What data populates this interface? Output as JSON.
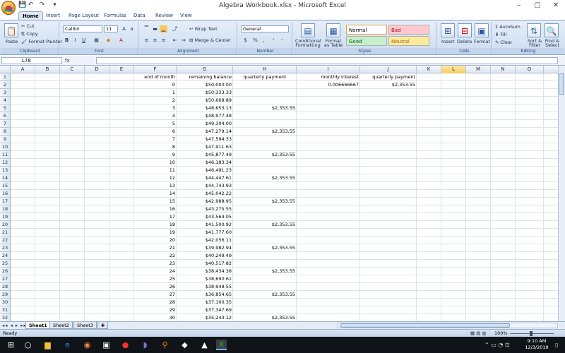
{
  "window": {
    "title": "Algebra Workbook.xlsx - Microsoft Excel",
    "controls": [
      "–",
      "▢",
      "✕"
    ]
  },
  "qat": [
    "💾",
    "↶",
    "↷",
    "▾"
  ],
  "tabs": [
    "Home",
    "Insert",
    "Page Layout",
    "Formulas",
    "Data",
    "Review",
    "View"
  ],
  "ribbon": {
    "clipboard": {
      "label": "Clipboard",
      "paste": "Paste",
      "cut": "Cut",
      "copy": "Copy",
      "format_painter": "Format Painter"
    },
    "font": {
      "label": "Font",
      "name": "Calibri",
      "size": "11"
    },
    "alignment": {
      "label": "Alignment",
      "wrap": "Wrap Text",
      "merge": "Merge & Center"
    },
    "number": {
      "label": "Number",
      "format": "General"
    },
    "styles": {
      "label": "Styles",
      "conditional": "Conditional Formatting",
      "format_table": "Format as Table",
      "cells": [
        {
          "name": "Normal",
          "bg": "#ffffff",
          "fg": "#000000"
        },
        {
          "name": "Bad",
          "bg": "#ffc7ce",
          "fg": "#9c0006"
        },
        {
          "name": "Good",
          "bg": "#c6efce",
          "fg": "#006100"
        },
        {
          "name": "Neutral",
          "bg": "#ffeb9c",
          "fg": "#9c6500"
        }
      ]
    },
    "cells": {
      "label": "Cells",
      "insert": "Insert",
      "delete": "Delete",
      "format": "Format"
    },
    "editing": {
      "label": "Editing",
      "autosum": "AutoSum",
      "fill": "Fill",
      "clear": "Clear",
      "sort": "Sort & Filter",
      "find": "Find & Select"
    }
  },
  "formula_bar": {
    "name_box": "L78",
    "fx": "fx",
    "formula": ""
  },
  "columns": [
    "A",
    "B",
    "C",
    "D",
    "E",
    "F",
    "G",
    "H",
    "I",
    "J",
    "K",
    "L",
    "M",
    "N",
    "O"
  ],
  "selected_column": "L",
  "header_row": {
    "F": "end of month",
    "G": "remaining balance",
    "H": "quarterly payment",
    "I": "monthly interest",
    "J": "quarterly payment"
  },
  "row2_extra": {
    "I": "0.006666667",
    "J": "$2,353.55"
  },
  "rows": [
    {
      "n": 2,
      "F": "0",
      "G": "$50,000.00",
      "H": ""
    },
    {
      "n": 3,
      "F": "1",
      "G": "$50,333.33",
      "H": ""
    },
    {
      "n": 4,
      "F": "2",
      "G": "$50,668.89",
      "H": ""
    },
    {
      "n": 5,
      "F": "3",
      "G": "$48,653.13",
      "H": "$2,353.55"
    },
    {
      "n": 6,
      "F": "4",
      "G": "$48,977.48",
      "H": ""
    },
    {
      "n": 7,
      "F": "5",
      "G": "$49,304.00",
      "H": ""
    },
    {
      "n": 8,
      "F": "6",
      "G": "$47,279.14",
      "H": "$2,353.55"
    },
    {
      "n": 9,
      "F": "7",
      "G": "$47,594.33",
      "H": ""
    },
    {
      "n": 10,
      "F": "8",
      "G": "$47,911.63",
      "H": ""
    },
    {
      "n": 11,
      "F": "9",
      "G": "$45,877.49",
      "H": "$2,353.55"
    },
    {
      "n": 12,
      "F": "10",
      "G": "$46,183.34",
      "H": ""
    },
    {
      "n": 13,
      "F": "11",
      "G": "$46,491.23",
      "H": ""
    },
    {
      "n": 14,
      "F": "12",
      "G": "$44,447.61",
      "H": "$2,353.55"
    },
    {
      "n": 15,
      "F": "13",
      "G": "$44,743.93",
      "H": ""
    },
    {
      "n": 16,
      "F": "14",
      "G": "$45,042.22",
      "H": ""
    },
    {
      "n": 17,
      "F": "15",
      "G": "$42,988.95",
      "H": "$2,353.55"
    },
    {
      "n": 18,
      "F": "16",
      "G": "$43,275.55",
      "H": ""
    },
    {
      "n": 19,
      "F": "17",
      "G": "$43,564.05",
      "H": ""
    },
    {
      "n": 20,
      "F": "18",
      "G": "$41,500.92",
      "H": "$2,353.55"
    },
    {
      "n": 21,
      "F": "19",
      "G": "$41,777.60",
      "H": ""
    },
    {
      "n": 22,
      "F": "20",
      "G": "$42,056.11",
      "H": ""
    },
    {
      "n": 23,
      "F": "21",
      "G": "$39,982.94",
      "H": "$2,353.55"
    },
    {
      "n": 24,
      "F": "22",
      "G": "$40,249.49",
      "H": ""
    },
    {
      "n": 25,
      "F": "23",
      "G": "$40,517.82",
      "H": ""
    },
    {
      "n": 26,
      "F": "24",
      "G": "$38,434.38",
      "H": "$2,353.55"
    },
    {
      "n": 27,
      "F": "25",
      "G": "$38,690.61",
      "H": ""
    },
    {
      "n": 28,
      "F": "26",
      "G": "$38,948.55",
      "H": ""
    },
    {
      "n": 29,
      "F": "27",
      "G": "$36,854.65",
      "H": "$2,353.55"
    },
    {
      "n": 30,
      "F": "28",
      "G": "$37,100.35",
      "H": ""
    },
    {
      "n": 31,
      "F": "29",
      "G": "$37,347.69",
      "H": ""
    },
    {
      "n": 32,
      "F": "30",
      "G": "$35,243.12",
      "H": "$2,353.55"
    }
  ],
  "sheets": [
    "Sheet1",
    "Sheet2",
    "Sheet3"
  ],
  "active_sheet": "Sheet1",
  "status": {
    "text": "Ready",
    "zoom": "100%"
  },
  "taskbar": {
    "time": "9:10 AM",
    "date": "12/3/2019"
  }
}
